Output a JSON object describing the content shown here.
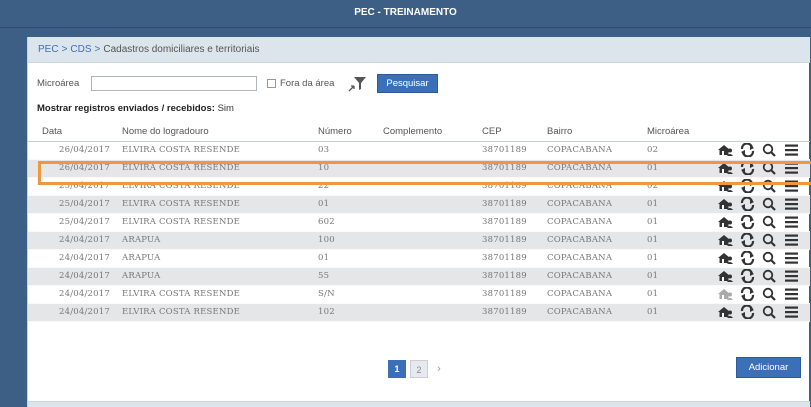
{
  "app": {
    "title": "PEC - TREINAMENTO"
  },
  "breadcrumb": {
    "item1": "PEC",
    "item2": "CDS",
    "item3": "Cadastros domiciliares e territoriais",
    "sep": ">"
  },
  "filters": {
    "microarea_label": "Microárea",
    "microarea_value": "",
    "fora_label": "Fora da área",
    "fora_checked": false,
    "search_button": "Pesquisar"
  },
  "sent_info": {
    "label": "Mostrar registros enviados / recebidos:",
    "value": "Sim"
  },
  "table": {
    "columns": [
      "Data",
      "Nome do logradouro",
      "Número",
      "Complemento",
      "CEP",
      "Bairro",
      "Microárea"
    ],
    "rows": [
      {
        "data": "26/04/2017",
        "logradouro": "ELVIRA COSTA RESENDE",
        "numero": "03",
        "complemento": "",
        "cep": "38701189",
        "bairro": "COPACABANA",
        "microarea": "02"
      },
      {
        "data": "26/04/2017",
        "logradouro": "ELVIRA COSTA RESENDE",
        "numero": "10",
        "complemento": "",
        "cep": "38701189",
        "bairro": "COPACABANA",
        "microarea": "01"
      },
      {
        "data": "25/04/2017",
        "logradouro": "ELVIRA COSTA RESENDE",
        "numero": "22",
        "complemento": "",
        "cep": "38701189",
        "bairro": "COPACABANA",
        "microarea": "02"
      },
      {
        "data": "25/04/2017",
        "logradouro": "ELVIRA COSTA RESENDE",
        "numero": "01",
        "complemento": "",
        "cep": "38701189",
        "bairro": "COPACABANA",
        "microarea": "01"
      },
      {
        "data": "25/04/2017",
        "logradouro": "ELVIRA COSTA RESENDE",
        "numero": "602",
        "complemento": "",
        "cep": "38701189",
        "bairro": "COPACABANA",
        "microarea": "01"
      },
      {
        "data": "24/04/2017",
        "logradouro": "ARAPUA",
        "numero": "100",
        "complemento": "",
        "cep": "38701189",
        "bairro": "COPACABANA",
        "microarea": "01"
      },
      {
        "data": "24/04/2017",
        "logradouro": "ARAPUA",
        "numero": "01",
        "complemento": "",
        "cep": "38701189",
        "bairro": "COPACABANA",
        "microarea": "01"
      },
      {
        "data": "24/04/2017",
        "logradouro": "ARAPUA",
        "numero": "55",
        "complemento": "",
        "cep": "38701189",
        "bairro": "COPACABANA",
        "microarea": "01"
      },
      {
        "data": "24/04/2017",
        "logradouro": "ELVIRA COSTA RESENDE",
        "numero": "S/N",
        "complemento": "",
        "cep": "38701189",
        "bairro": "COPACABANA",
        "microarea": "01"
      },
      {
        "data": "24/04/2017",
        "logradouro": "ELVIRA COSTA RESENDE",
        "numero": "102",
        "complemento": "",
        "cep": "38701189",
        "bairro": "COPACABANA",
        "microarea": "01"
      }
    ],
    "row_actions": [
      "house-family-icon",
      "refresh-icon",
      "magnifier-icon",
      "menu-icon"
    ],
    "selected_row_index": 1
  },
  "pagination": {
    "current": "1",
    "next_page": "2",
    "next_arrow": "›"
  },
  "add_button": "Adicionar",
  "colors": {
    "header_bg": "#3d5f86",
    "accent": "#3b70b8",
    "highlight_border": "#f0963c",
    "alt_row": "#e4e6e8"
  }
}
